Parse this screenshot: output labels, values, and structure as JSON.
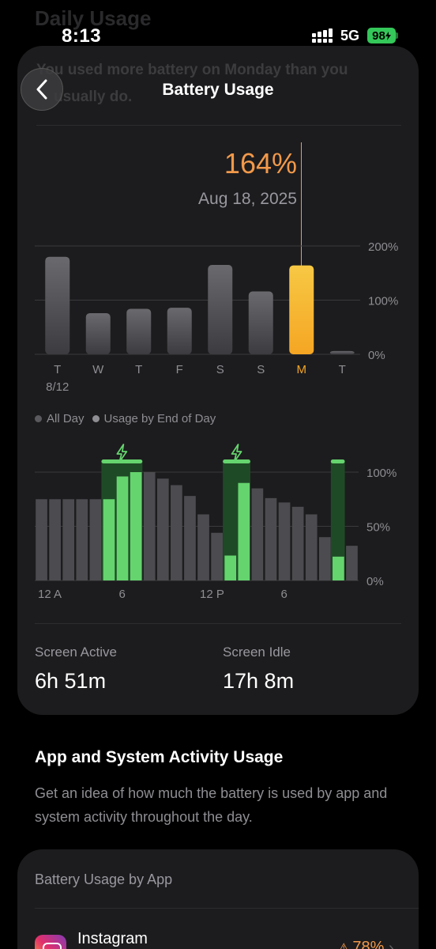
{
  "status_bar": {
    "time": "8:13",
    "network": "5G",
    "battery_level": "98",
    "charging": true
  },
  "background_header": "Daily Usage",
  "card_message": {
    "line1": "You used more battery on Monday than you",
    "line2": "usually do."
  },
  "nav": {
    "title": "Battery Usage",
    "back_icon": "chevron-left-icon"
  },
  "selection": {
    "value": "164%",
    "date": "Aug 18, 2025"
  },
  "chart_data": [
    {
      "type": "bar",
      "categories": [
        "T",
        "W",
        "T",
        "F",
        "S",
        "S",
        "M",
        "T"
      ],
      "first_date_label": "8/12",
      "values": [
        180,
        76,
        84,
        86,
        165,
        116,
        164,
        6
      ],
      "highlighted_index": 6,
      "ylim": [
        0,
        200
      ],
      "yticks": [
        "200%",
        "100%",
        "0%"
      ],
      "colors": {
        "bar": "#58585c",
        "highlight": "#f5a623",
        "highlight_top": "#f7c844"
      }
    },
    {
      "type": "bar",
      "x_tick_labels": [
        "12 A",
        "6",
        "12 P",
        "6"
      ],
      "values": [
        75,
        75,
        75,
        75,
        75,
        75,
        96,
        100,
        100,
        94,
        88,
        78,
        61,
        44,
        23,
        90,
        85,
        76,
        72,
        68,
        61,
        40,
        22,
        32
      ],
      "charging": [
        false,
        false,
        false,
        false,
        false,
        true,
        true,
        true,
        false,
        false,
        false,
        false,
        false,
        false,
        true,
        true,
        false,
        false,
        false,
        false,
        false,
        false,
        true,
        false
      ],
      "ylim": [
        0,
        100
      ],
      "yticks": [
        "100%",
        "50%",
        "0%"
      ],
      "colors": {
        "bar": "#4c4c50",
        "charging": "#65d46e",
        "charging_band": "#1f4a26"
      }
    }
  ],
  "legend": {
    "all_day": "All Day",
    "end_of_day": "Usage by End of Day"
  },
  "stats": {
    "screen_active_label": "Screen Active",
    "screen_active_value": "6h 51m",
    "screen_idle_label": "Screen Idle",
    "screen_idle_value": "17h 8m"
  },
  "activity": {
    "title": "App and System Activity Usage",
    "description": "Get an idea of how much the battery is used by app and system activity throughout the day."
  },
  "by_app": {
    "title": "Battery Usage by App",
    "apps": [
      {
        "name": "Instagram",
        "percent": "78%",
        "icon": "instagram-icon"
      }
    ]
  }
}
